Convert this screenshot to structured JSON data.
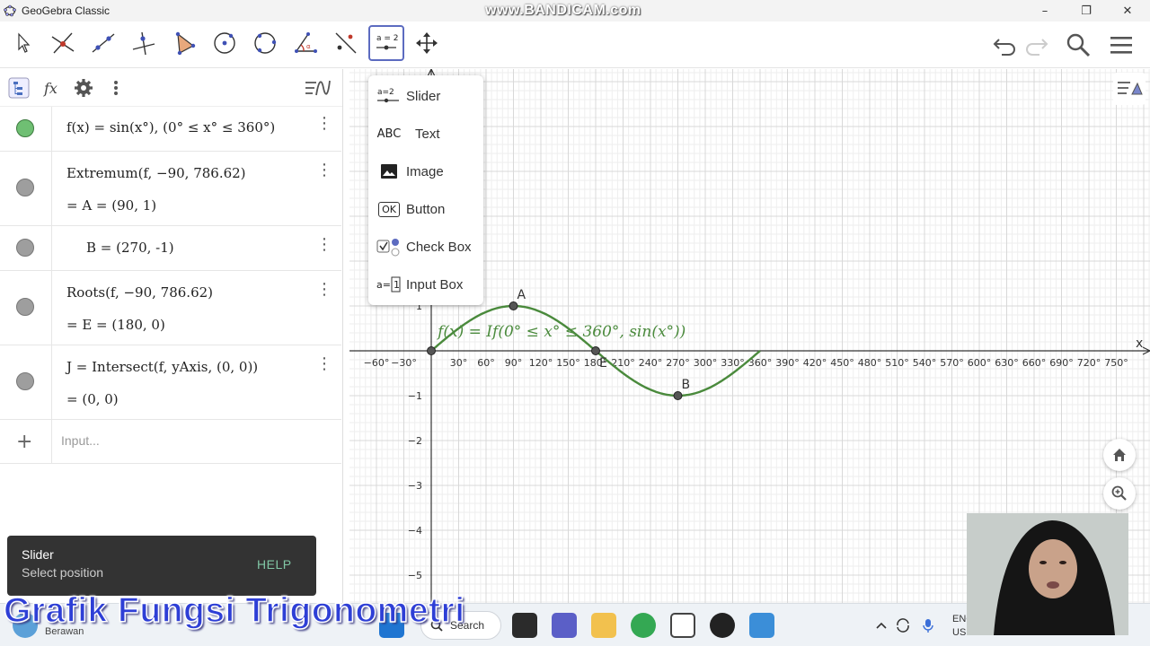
{
  "window": {
    "title": "GeoGebra Classic",
    "watermark": "www.BANDICAM.com",
    "controls": [
      "–",
      "❐",
      "✕"
    ]
  },
  "toolbar": {
    "tools": [
      {
        "name": "move-tool-icon"
      },
      {
        "name": "point-tool-icon"
      },
      {
        "name": "line-tool-icon"
      },
      {
        "name": "perpendicular-line-tool-icon"
      },
      {
        "name": "polygon-tool-icon"
      },
      {
        "name": "circle-center-point-tool-icon"
      },
      {
        "name": "circle-three-points-tool-icon"
      },
      {
        "name": "angle-tool-icon"
      },
      {
        "name": "reflect-tool-icon"
      },
      {
        "name": "slider-tool-icon",
        "label": "a = 2",
        "active": true
      },
      {
        "name": "move-graphics-view-tool-icon"
      }
    ],
    "right": [
      "undo-icon",
      "redo-icon",
      "search-icon",
      "menu-icon"
    ]
  },
  "algebra": {
    "rows": [
      {
        "line1": "f(x)  =  sin(x°),     (0° ≤ x° ≤ 360°)",
        "line2": "",
        "color": "green"
      },
      {
        "line1": "Extremum(f, −90, 786.62)",
        "line2": "=  A  =  (90,  1)",
        "color": "gray"
      },
      {
        "line1": "B  =  (270,  -1)",
        "line2": "",
        "color": "gray"
      },
      {
        "line1": "Roots(f, −90, 786.62)",
        "line2": "=  E  =  (180,  0)",
        "color": "gray"
      },
      {
        "line1": "J  =  Intersect(f, yAxis, (0, 0))",
        "line2": "=  (0,  0)",
        "color": "gray"
      }
    ],
    "input_placeholder": "Input..."
  },
  "menu": {
    "items": [
      {
        "icon": "a=2",
        "label": "Slider"
      },
      {
        "icon": "ABC",
        "label": "Text"
      },
      {
        "icon": "image",
        "label": "Image"
      },
      {
        "icon": "OK",
        "label": "Button"
      },
      {
        "icon": "checkbox",
        "label": "Check Box"
      },
      {
        "icon": "a=1",
        "label": "Input Box"
      }
    ]
  },
  "graph": {
    "x_ticks": [
      "−60°",
      "−30°",
      "30°",
      "60°",
      "90°",
      "120°",
      "150°",
      "180°",
      "210°",
      "240°",
      "270°",
      "300°",
      "330°",
      "360°",
      "390°",
      "420°",
      "450°",
      "480°",
      "510°",
      "540°",
      "570°",
      "600°",
      "630°",
      "660°",
      "690°",
      "720°",
      "750°"
    ],
    "y_ticks": [
      "1",
      "−1",
      "−2",
      "−3",
      "−4",
      "−5"
    ],
    "x_axis_label": "x",
    "function_label": "f(x)  =  If(0° ≤ x° ≤ 360°, sin(x°))",
    "points": [
      {
        "label": "A",
        "x": 90,
        "y": 1
      },
      {
        "label": "B",
        "x": 270,
        "y": -1
      },
      {
        "label": "E",
        "x": 180,
        "y": 0
      },
      {
        "label": "",
        "x": 0,
        "y": 0
      }
    ],
    "curve_color": "#4a8a3c"
  },
  "snackbar": {
    "title": "Slider",
    "subtitle": "Select position",
    "action": "HELP"
  },
  "taskbar": {
    "weather": "Berawan",
    "search": "Search",
    "lang_line1": "ENG",
    "lang_line2": "US"
  },
  "overlay_caption": "Grafik Fungsi Trigonometri"
}
